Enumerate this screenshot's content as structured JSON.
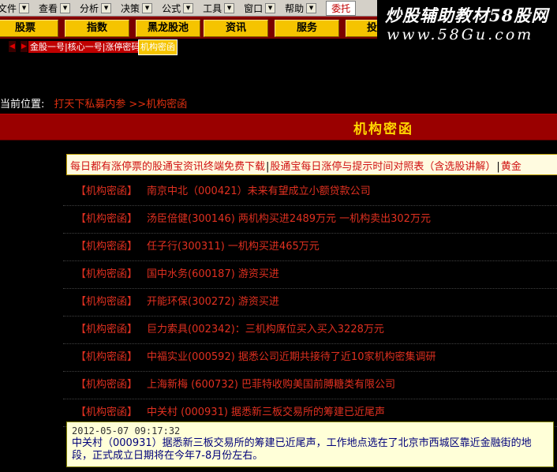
{
  "menu": [
    {
      "label": "文件(F)",
      "shown": "文件",
      "name": "menu-file"
    },
    {
      "label": "查看",
      "name": "menu-view"
    },
    {
      "label": "分析",
      "name": "menu-analysis"
    },
    {
      "label": "决策",
      "name": "menu-decision"
    },
    {
      "label": "公式",
      "name": "menu-formula"
    },
    {
      "label": "工具",
      "name": "menu-tools"
    },
    {
      "label": "窗口",
      "name": "menu-window"
    },
    {
      "label": "帮助",
      "name": "menu-help"
    }
  ],
  "menu_active": "委托",
  "watermark": {
    "line1": "炒股辅助教材58股网",
    "line2": "www.58Gu.com"
  },
  "toolbar": [
    "股票",
    "指数",
    "黑龙股池",
    "资讯",
    "服务",
    "投"
  ],
  "tabs": {
    "news": "金股一号|核心一号|涨停密码",
    "active": "机构密函"
  },
  "breadcrumb": {
    "label": "当前位置:",
    "link": "打天下私募内参",
    "current": ">>机构密函"
  },
  "page_title": "机构密函",
  "marquee": [
    "每日都有涨停票的股通宝资讯终端免费下载",
    "股通宝每日涨停与提示时间对照表（含选股讲解）",
    "黄金"
  ],
  "news_tag": "【机构密函】",
  "news": [
    "南京中北（000421）未来有望成立小额贷款公司",
    "汤臣倍健(300146) 两机构买进2489万元 一机构卖出302万元",
    "任子行(300311) 一机构买进465万元",
    "国中水务(600187) 游资买进",
    "开能环保(300272) 游资买进",
    "巨力索具(002342)：三机构席位买入买入3228万元",
    "中福实业(000592) 据悉公司近期共接待了近10家机构密集调研",
    "上海新梅 (600732) 巴菲特收购美国前膊糖类有限公司",
    "中关村 (000931) 据悉新三板交易所的筹建已近尾声"
  ],
  "tooltip": {
    "time": "2012-05-07 09:17:32",
    "body": "中关村（000931）据悉新三板交易所的筹建已近尾声，工作地点选在了北京市西城区靠近金融街的地段，正式成立日期将在今年7-8月份左右。"
  },
  "colors": {
    "accent_red": "#9a0000",
    "gold": "#ffd700",
    "link_red": "#e03020",
    "button_yellow": "#f5c400"
  }
}
